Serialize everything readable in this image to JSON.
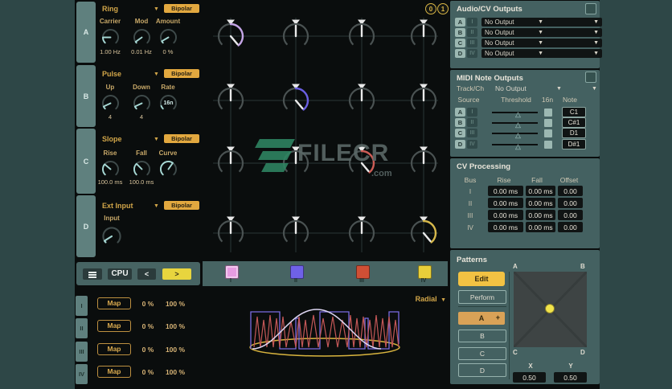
{
  "icons": {
    "chevron_down": "▼",
    "triangle_up": "△"
  },
  "matrix": {
    "badge_zero": "0",
    "badge_one": "1",
    "active_cells": [
      "A-I",
      "B-II",
      "C-III",
      "D-IV"
    ],
    "active_colors": {
      "a1": "#c4a4e6",
      "b2": "#6a5ee2",
      "c3": "#cd5c55",
      "d4": "#d6b84a"
    }
  },
  "oscillators": [
    {
      "tab": "A",
      "type": "Ring",
      "polarity": "Bipolar",
      "params": [
        {
          "label": "Carrier",
          "value": "1.00 Hz"
        },
        {
          "label": "Mod",
          "value": "0.01 Hz"
        },
        {
          "label": "Amount",
          "value": "0 %"
        }
      ]
    },
    {
      "tab": "B",
      "type": "Pulse",
      "polarity": "Bipolar",
      "params": [
        {
          "label": "Up",
          "value": "4"
        },
        {
          "label": "Down",
          "value": "4"
        },
        {
          "label": "Rate",
          "value": "16n"
        }
      ]
    },
    {
      "tab": "C",
      "type": "Slope",
      "polarity": "Bipolar",
      "params": [
        {
          "label": "Rise",
          "value": "100.0 ms"
        },
        {
          "label": "Fall",
          "value": "100.0 ms"
        },
        {
          "label": "Curve",
          "value": ""
        }
      ]
    },
    {
      "tab": "D",
      "type": "Ext Input",
      "polarity": "Bipolar",
      "params": [
        {
          "label": "Input",
          "value": ""
        }
      ]
    }
  ],
  "toolbar": {
    "cpu_label": "CPU",
    "prev_label": "<",
    "next_label": ">"
  },
  "map_rows": [
    {
      "bus": "I",
      "button": "Map",
      "min": "0 %",
      "max": "100 %"
    },
    {
      "bus": "II",
      "button": "Map",
      "min": "0 %",
      "max": "100 %"
    },
    {
      "bus": "III",
      "button": "Map",
      "min": "0 %",
      "max": "100 %"
    },
    {
      "bus": "IV",
      "button": "Map",
      "min": "0 %",
      "max": "100 %"
    }
  ],
  "buses": [
    {
      "numeral": "I",
      "color": "#e79ce2"
    },
    {
      "numeral": "II",
      "color": "#6f61e8"
    },
    {
      "numeral": "III",
      "color": "#cf4f35"
    },
    {
      "numeral": "IV",
      "color": "#e8cf3a"
    }
  ],
  "viz": {
    "mode": "Radial"
  },
  "audio_cv": {
    "title": "Audio/CV Outputs",
    "rows": [
      {
        "source": "A",
        "bus": "I",
        "output": "No Output"
      },
      {
        "source": "B",
        "bus": "II",
        "output": "No Output"
      },
      {
        "source": "C",
        "bus": "III",
        "output": "No Output"
      },
      {
        "source": "D",
        "bus": "IV",
        "output": "No Output"
      }
    ]
  },
  "midi": {
    "title": "MIDI Note Outputs",
    "track_label": "Track/Ch",
    "track_value": "No Output",
    "headers": {
      "source": "Source",
      "threshold": "Threshold",
      "rate": "16n",
      "note": "Note"
    },
    "rows": [
      {
        "source": "A",
        "bus": "I",
        "note": "C1"
      },
      {
        "source": "B",
        "bus": "II",
        "note": "C#1"
      },
      {
        "source": "C",
        "bus": "III",
        "note": "D1"
      },
      {
        "source": "D",
        "bus": "IV",
        "note": "D#1"
      }
    ]
  },
  "cv_processing": {
    "title": "CV Processing",
    "headers": {
      "bus": "Bus",
      "rise": "Rise",
      "fall": "Fall",
      "offset": "Offset"
    },
    "rows": [
      {
        "bus": "I",
        "rise": "0.00 ms",
        "fall": "0.00 ms",
        "offset": "0.00"
      },
      {
        "bus": "II",
        "rise": "0.00 ms",
        "fall": "0.00 ms",
        "offset": "0.00"
      },
      {
        "bus": "III",
        "rise": "0.00 ms",
        "fall": "0.00 ms",
        "offset": "0.00"
      },
      {
        "bus": "IV",
        "rise": "0.00 ms",
        "fall": "0.00 ms",
        "offset": "0.00"
      }
    ]
  },
  "patterns": {
    "title": "Patterns",
    "edit": "Edit",
    "perform": "Perform",
    "slots": [
      {
        "label": "A",
        "add": "+"
      },
      {
        "label": "B"
      },
      {
        "label": "C"
      },
      {
        "label": "D"
      }
    ],
    "pad_corners": {
      "tl": "A",
      "tr": "B",
      "bl": "C",
      "br": "D"
    },
    "x_label": "X",
    "x_value": "0.50",
    "y_label": "Y",
    "y_value": "0.50"
  },
  "watermark": {
    "text": "FILECR",
    "domain": ".com"
  },
  "colors": {
    "page_bg": "#2e4747",
    "panel_teal": "#446161",
    "panel_black": "#0a0d0d",
    "accent_amber": "#e2a83f",
    "accent_yellow": "#e8d53e",
    "knob_teal": "#a7d9d5"
  }
}
